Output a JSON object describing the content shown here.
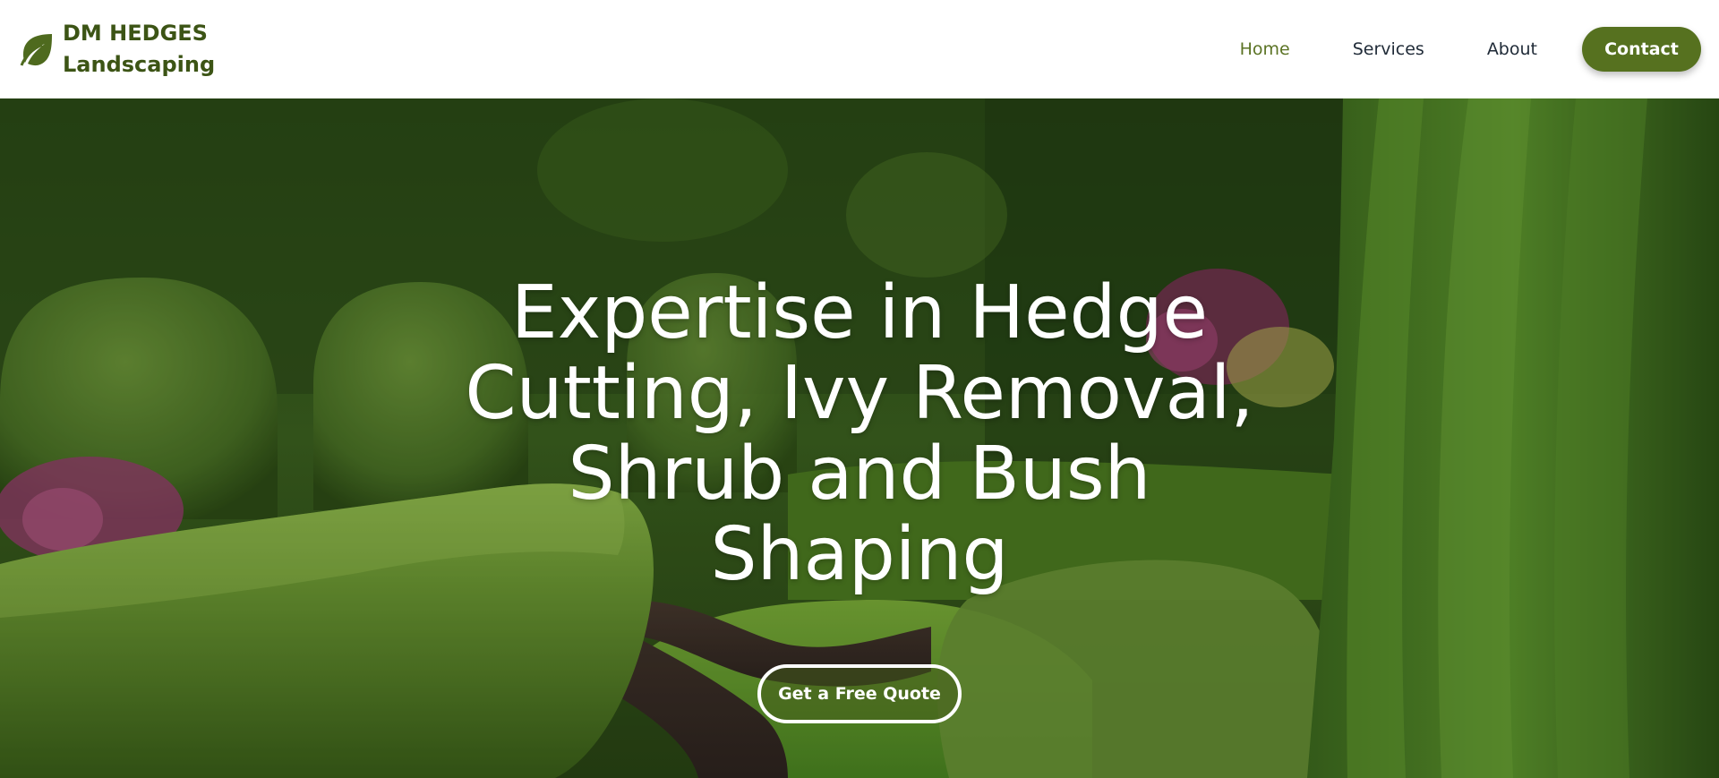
{
  "brand": {
    "icon": "leaf-icon",
    "line1": "DM HEDGES",
    "line2": "Landscaping",
    "color": "#3c5415"
  },
  "nav": {
    "items": [
      {
        "label": "Home",
        "active": true
      },
      {
        "label": "Services",
        "active": false
      },
      {
        "label": "About",
        "active": false
      }
    ],
    "contact_label": "Contact",
    "accent": "#56711f"
  },
  "hero": {
    "title": "Expertise in Hedge Cutting, Ivy Removal, Shrub and Bush Shaping",
    "cta_label": "Get a Free Quote"
  }
}
